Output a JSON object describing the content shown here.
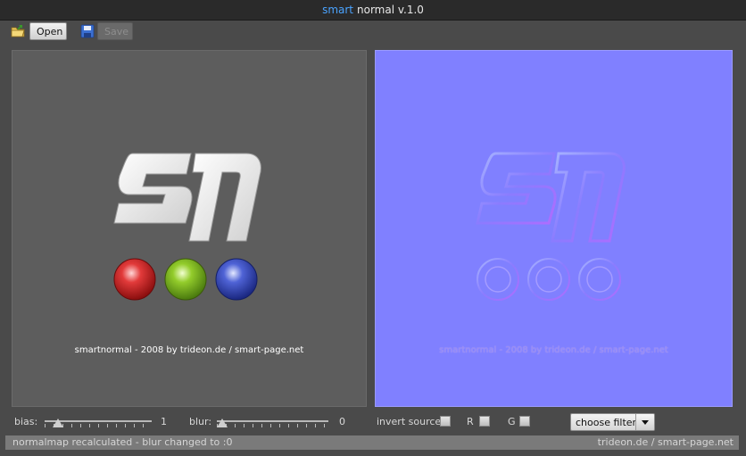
{
  "window": {
    "title_accent": "smart",
    "title_rest": "normal v.1.0"
  },
  "toolbar": {
    "open_label": "Open",
    "save_label": "Save"
  },
  "preview": {
    "source_credit": "smartnormal - 2008 by trideon.de / smart-page.net",
    "normal_credit": "smartnormal - 2008 by trideon.de / smart-page.net"
  },
  "controls": {
    "bias": {
      "label": "bias:",
      "value": "1",
      "level": 0.08
    },
    "blur": {
      "label": "blur:",
      "value": "0",
      "level": 0.0
    },
    "invert_source_label": "invert source",
    "r_label": "R",
    "g_label": "G",
    "filter_select": {
      "selected": "choose filter"
    }
  },
  "status": {
    "message": "normalmap recalculated - blur changed to :0",
    "link1": "trideon.de",
    "separator": "/",
    "link2": "smart-page.net"
  },
  "colors": {
    "accent": "#4aa3ff",
    "normal_bg": "#8080ff",
    "source_bg": "#5d5d5d"
  }
}
